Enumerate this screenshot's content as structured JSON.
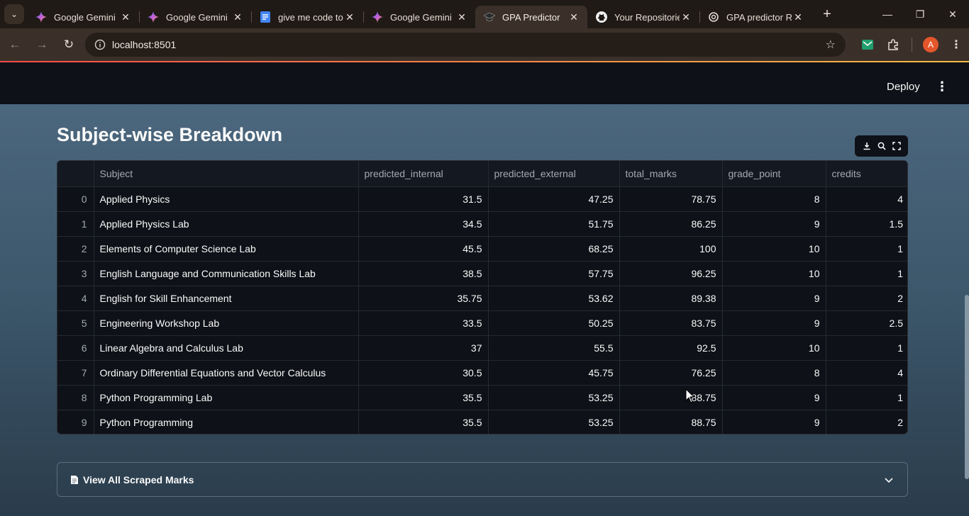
{
  "browser": {
    "tabs": [
      {
        "title": "Google Gemini",
        "icon": "gemini-icon",
        "active": false
      },
      {
        "title": "Google Gemini",
        "icon": "gemini-icon",
        "active": false
      },
      {
        "title": "give me code to",
        "icon": "docs-icon",
        "active": false
      },
      {
        "title": "Google Gemini",
        "icon": "gemini-icon",
        "active": false
      },
      {
        "title": "GPA Predictor",
        "icon": "graduation-cap-icon",
        "active": true
      },
      {
        "title": "Your Repositorie",
        "icon": "github-icon",
        "active": false
      },
      {
        "title": "GPA predictor RE",
        "icon": "openai-icon",
        "active": false
      }
    ],
    "url": "localhost:8501",
    "profile_initial": "A",
    "colors": {
      "chrome_dark": "#1f1a16",
      "chrome_toolbar": "#3b3029",
      "profile": "#e3562b"
    }
  },
  "app": {
    "deploy_label": "Deploy",
    "title": "Subject-wise Breakdown",
    "table": {
      "columns": [
        "",
        "Subject",
        "predicted_internal",
        "predicted_external",
        "total_marks",
        "grade_point",
        "credits"
      ],
      "rows": [
        [
          "0",
          "Applied Physics",
          "31.5",
          "47.25",
          "78.75",
          "8",
          "4"
        ],
        [
          "1",
          "Applied Physics Lab",
          "34.5",
          "51.75",
          "86.25",
          "9",
          "1.5"
        ],
        [
          "2",
          "Elements of Computer Science Lab",
          "45.5",
          "68.25",
          "100",
          "10",
          "1"
        ],
        [
          "3",
          "English Language and Communication Skills Lab",
          "38.5",
          "57.75",
          "96.25",
          "10",
          "1"
        ],
        [
          "4",
          "English for Skill Enhancement",
          "35.75",
          "53.62",
          "89.38",
          "9",
          "2"
        ],
        [
          "5",
          "Engineering Workshop Lab",
          "33.5",
          "50.25",
          "83.75",
          "9",
          "2.5"
        ],
        [
          "6",
          "Linear Algebra and Calculus Lab",
          "37",
          "55.5",
          "92.5",
          "10",
          "1"
        ],
        [
          "7",
          "Ordinary Differential Equations and Vector Calculus",
          "30.5",
          "45.75",
          "76.25",
          "8",
          "4"
        ],
        [
          "8",
          "Python Programming Lab",
          "35.5",
          "53.25",
          "88.75",
          "9",
          "1"
        ],
        [
          "9",
          "Python Programming",
          "35.5",
          "53.25",
          "88.75",
          "9",
          "2"
        ]
      ]
    },
    "expander_label": "View All Scraped Marks",
    "colors": {
      "background_top": "#4f6b82",
      "background_bottom": "#2a3c4b",
      "table_bg": "#0e1117"
    }
  }
}
